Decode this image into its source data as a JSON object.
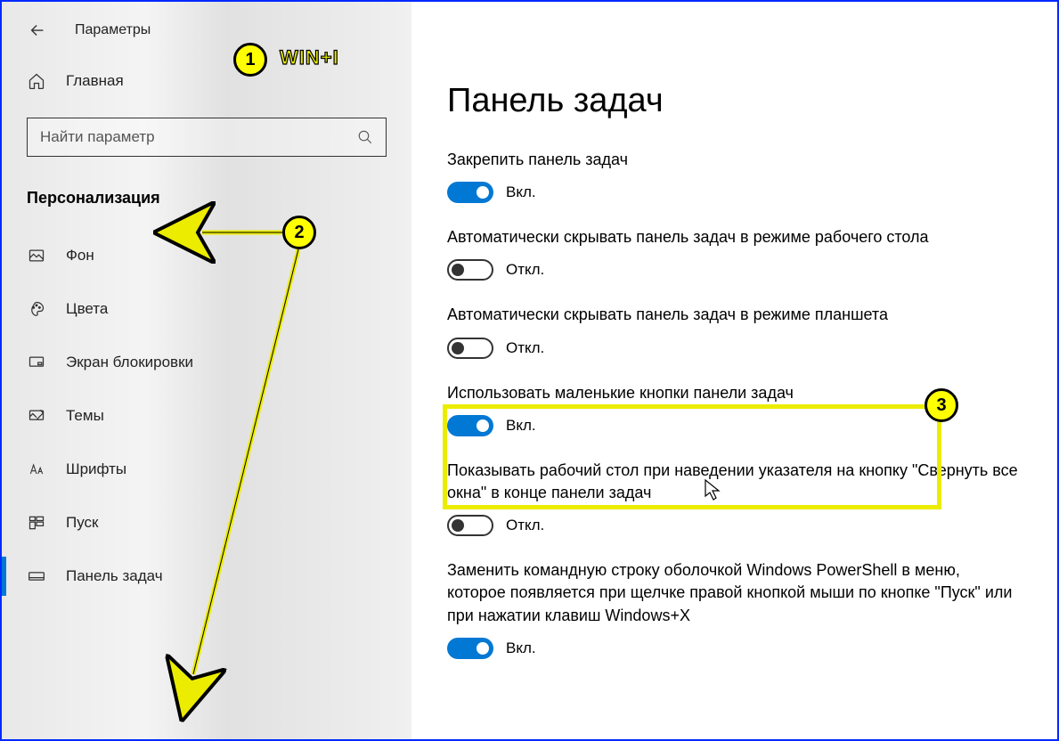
{
  "header": {
    "title": "Параметры"
  },
  "sidebar": {
    "home": "Главная",
    "search_placeholder": "Найти параметр",
    "category": "Персонализация",
    "items": [
      {
        "label": "Фон"
      },
      {
        "label": "Цвета"
      },
      {
        "label": "Экран блокировки"
      },
      {
        "label": "Темы"
      },
      {
        "label": "Шрифты"
      },
      {
        "label": "Пуск"
      },
      {
        "label": "Панель задач"
      }
    ]
  },
  "main": {
    "title": "Панель задач",
    "settings": [
      {
        "label": "Закрепить панель задач",
        "on": true,
        "state": "Вкл."
      },
      {
        "label": "Автоматически скрывать панель задач в режиме рабочего стола",
        "on": false,
        "state": "Откл."
      },
      {
        "label": "Автоматически скрывать панель задач в режиме планшета",
        "on": false,
        "state": "Откл."
      },
      {
        "label": "Использовать маленькие кнопки панели задач",
        "on": true,
        "state": "Вкл."
      },
      {
        "label": "Показывать рабочий стол при наведении указателя на кнопку \"Свернуть все окна\" в конце панели задач",
        "on": false,
        "state": "Откл."
      },
      {
        "label": "Заменить командную строку оболочкой Windows PowerShell в меню, которое появляется при щелчке правой кнопкой мыши по кнопке \"Пуск\" или при нажатии клавиш Windows+X",
        "on": true,
        "state": "Вкл."
      }
    ]
  },
  "annotations": {
    "badges": [
      "1",
      "2",
      "3"
    ],
    "shortcut": "WIN+I"
  },
  "state_labels": {
    "on": "Вкл.",
    "off": "Откл."
  }
}
